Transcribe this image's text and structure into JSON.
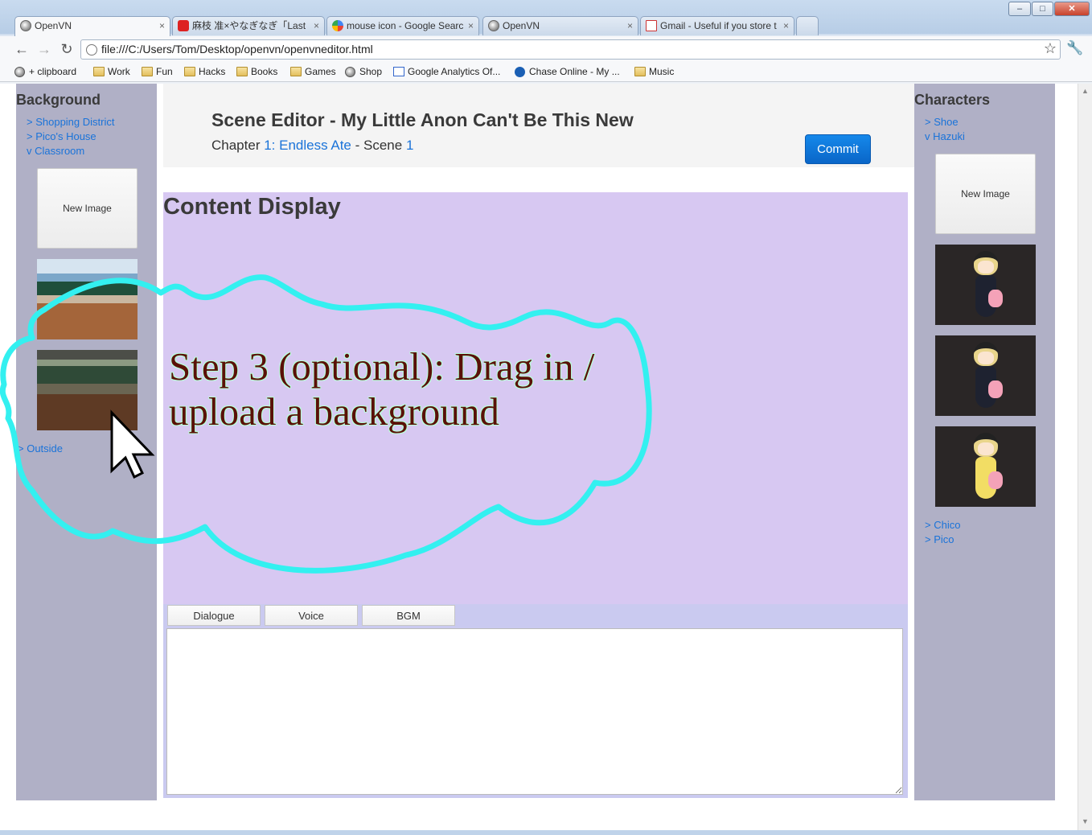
{
  "browser": {
    "tabs": [
      {
        "title": "OpenVN",
        "icon": "globe-icon",
        "active": true
      },
      {
        "title": "麻枝 准×やなぎなぎ「Last S",
        "icon": "youtube-icon",
        "active": false
      },
      {
        "title": "mouse icon - Google Search",
        "icon": "google-icon",
        "active": false
      },
      {
        "title": "OpenVN",
        "icon": "globe-icon",
        "active": false
      },
      {
        "title": "Gmail - Useful if you store t",
        "icon": "gmail-icon",
        "active": false
      }
    ],
    "tab_close": "×",
    "url": "file:///C:/Users/Tom/Desktop/openvn/openvneditor.html",
    "bookmarks": [
      {
        "label": "+ clipboard",
        "icon": "globe-icon"
      },
      {
        "label": "Work",
        "icon": "folder-icon"
      },
      {
        "label": "Fun",
        "icon": "folder-icon"
      },
      {
        "label": "Hacks",
        "icon": "folder-icon"
      },
      {
        "label": "Books",
        "icon": "folder-icon"
      },
      {
        "label": "Games",
        "icon": "folder-icon"
      },
      {
        "label": "Shop",
        "icon": "globe-icon"
      },
      {
        "label": "Google Analytics Of...",
        "icon": "chart-icon"
      },
      {
        "label": "Chase Online - My ...",
        "icon": "chase-icon"
      },
      {
        "label": "Music",
        "icon": "folder-icon"
      }
    ]
  },
  "left_sidebar": {
    "title": "Background",
    "items": [
      "> Shopping District",
      "> Pico's House",
      "v Classroom"
    ],
    "new_image_label": "New Image",
    "thumbnails": [
      "classroom-bright",
      "classroom-dark"
    ],
    "bottom_items": [
      "> Outside"
    ]
  },
  "header": {
    "title": "Scene Editor - My Little Anon Can't Be This New",
    "chapter_prefix": "Chapter ",
    "chapter_link": "1: Endless Ate",
    "scene_prefix": " - Scene ",
    "scene_link": "1",
    "commit_label": "Commit"
  },
  "content": {
    "title": "Content Display"
  },
  "editor_tabs": [
    "Dialogue",
    "Voice",
    "BGM"
  ],
  "editor_text": "",
  "right_sidebar": {
    "title": "Characters",
    "items": [
      "> Shoe",
      "v Hazuki"
    ],
    "new_image_label": "New Image",
    "portraits": [
      "hazuki-1",
      "hazuki-2",
      "hazuki-3"
    ],
    "bottom_items": [
      "> Chico",
      "> Pico"
    ]
  },
  "annotation": {
    "text": "Step 3 (optional): Drag in / upload a background",
    "outline_color": "#33f0f0",
    "text_color": "#5a1008"
  }
}
